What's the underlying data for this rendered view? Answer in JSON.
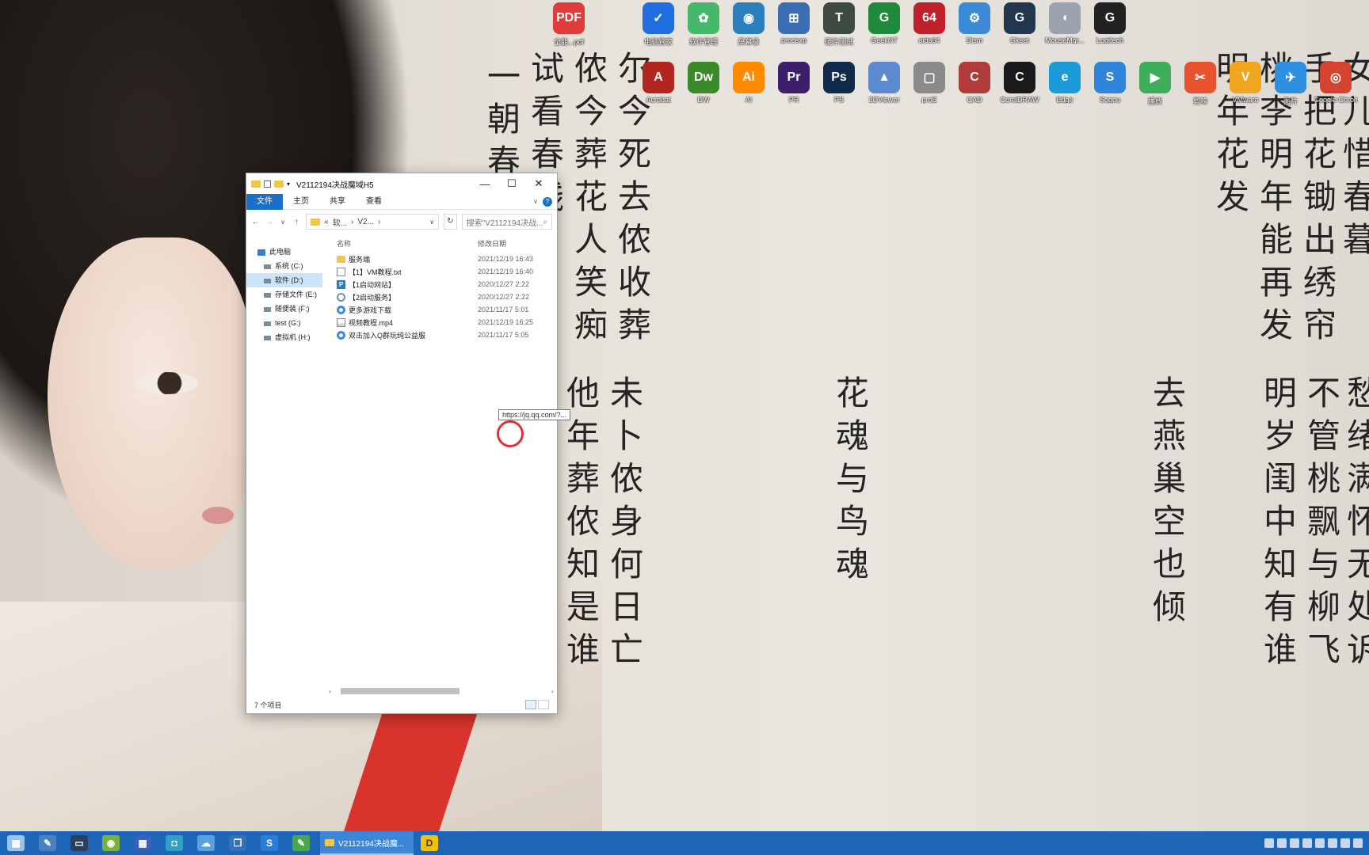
{
  "explorer": {
    "title": "V2112194决战魔域H5",
    "ribbon_tabs": [
      "文件",
      "主页",
      "共享",
      "查看"
    ],
    "address": {
      "crumb1": "软...",
      "crumb2": "V2...",
      "prefix": "«"
    },
    "search_placeholder": "搜索\"V2112194决战...",
    "nav": {
      "root": "此电脑",
      "drives": [
        "系统 (C:)",
        "软件 (D:)",
        "存储文件 (E:)",
        "随便装 (F:)",
        "test (G:)",
        "虚拟机 (H:)"
      ]
    },
    "columns": {
      "name": "名称",
      "date": "修改日期"
    },
    "files": [
      {
        "name": "服务端",
        "date": "2021/12/19 16:43",
        "icon": "folder"
      },
      {
        "name": "【1】VM教程.txt",
        "date": "2021/12/19 16:40",
        "icon": "txt"
      },
      {
        "name": "【1启动网站】",
        "date": "2020/12/27 2:22",
        "icon": "p"
      },
      {
        "name": "【2启动服务】",
        "date": "2020/12/27 2:22",
        "icon": "gear"
      },
      {
        "name": "更多游戏下载",
        "date": "2021/11/17 5:01",
        "icon": "web"
      },
      {
        "name": "视频教程.mp4",
        "date": "2021/12/19 16:25",
        "icon": "mp4"
      },
      {
        "name": "双击加入Q群玩纯公益服",
        "date": "2021/11/17 5:05",
        "icon": "web"
      }
    ],
    "tooltip": "https://jq.qq.com/?...",
    "status": "7 个项目"
  },
  "desktop_icons": [
    {
      "label": "全能...pdf",
      "glyph": "PDF",
      "color": "#e23b3b"
    },
    {
      "label": "电脑管家",
      "glyph": "✓",
      "color": "#1f6fe0"
    },
    {
      "label": "软件管理",
      "glyph": "✿",
      "color": "#46b86a"
    },
    {
      "label": "屏幕录",
      "glyph": "◉",
      "color": "#2a7fbf"
    },
    {
      "label": "procexp",
      "glyph": "⊞",
      "color": "#3b6db3"
    },
    {
      "label": "硬件测试",
      "glyph": "T",
      "color": "#3d4a3f"
    },
    {
      "label": "GeekNT",
      "glyph": "G",
      "color": "#1f8a3c"
    },
    {
      "label": "aida64",
      "glyph": "64",
      "color": "#c0202a"
    },
    {
      "label": "Dism",
      "glyph": "⚙",
      "color": "#3b8ad8"
    },
    {
      "label": "Gkeet",
      "glyph": "G",
      "color": "#22364d"
    },
    {
      "label": "MouseMgr...",
      "glyph": "◖",
      "color": "#9aa3ad"
    },
    {
      "label": "Logitech",
      "glyph": "G",
      "color": "#222222"
    },
    {
      "label": "Acrobat",
      "glyph": "A",
      "color": "#b3261e"
    },
    {
      "label": "DW",
      "glyph": "Dw",
      "color": "#3a8a2a"
    },
    {
      "label": "AI",
      "glyph": "Ai",
      "color": "#ff8a00"
    },
    {
      "label": "PR",
      "glyph": "Pr",
      "color": "#3d1e6b"
    },
    {
      "label": "PS",
      "glyph": "Ps",
      "color": "#0f2a4a"
    },
    {
      "label": "3DViewer",
      "glyph": "▲",
      "color": "#5c8ad0"
    },
    {
      "label": "proE",
      "glyph": "▢",
      "color": "#8a8a8a"
    },
    {
      "label": "CAD",
      "glyph": "C",
      "color": "#b13a3a"
    },
    {
      "label": "CorelDRAW",
      "glyph": "C",
      "color": "#1a1a1a"
    },
    {
      "label": "Edge",
      "glyph": "e",
      "color": "#1a9bd7"
    },
    {
      "label": "Sogou",
      "glyph": "S",
      "color": "#2f85d9"
    },
    {
      "label": "播放",
      "glyph": "▶",
      "color": "#3fae5a"
    },
    {
      "label": "剪映",
      "glyph": "✂",
      "color": "#e8522f"
    },
    {
      "label": "VMware",
      "glyph": "V",
      "color": "#f0a71f"
    },
    {
      "label": "图片",
      "glyph": "✈",
      "color": "#2f8fe0"
    },
    {
      "label": "Google Chrome",
      "glyph": "◎",
      "color": "#d4432f"
    }
  ],
  "taskbar": {
    "active_label": "V2112194决战魔...",
    "items": [
      "start",
      "explorer",
      "monitor",
      "android",
      "app",
      "robot",
      "cloud",
      "copy",
      "sogou",
      "notes"
    ]
  }
}
